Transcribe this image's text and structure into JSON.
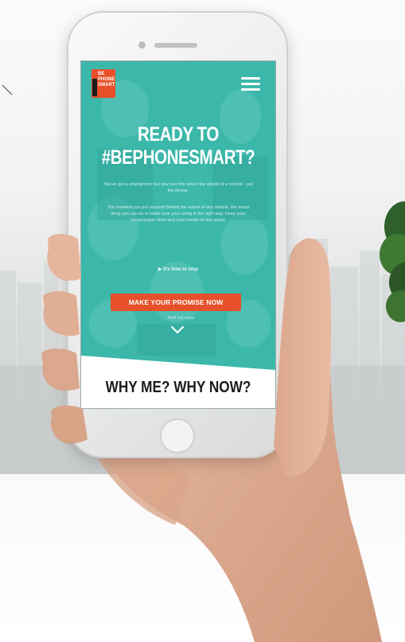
{
  "app": {
    "logo_lines": [
      "BE",
      "PHONE",
      "SMART"
    ],
    "menu_icon": "hamburger-menu-icon"
  },
  "hero": {
    "title_line1": "READY TO",
    "title_line2": "#BEPHONESMART?",
    "paragraph1": "You've got a smartphone but you lose the wheel the ahead of a vehicle - put the phone.",
    "paragraph2": "The moment you put yourself behind the wheel of any vehicle, the smart thing you can do is make sure your using in the right way. Keep your conversation short and your hands on the wheel.",
    "link_text": "▶ It's time to stop",
    "cta_label": "MAKE YOUR PROMISE NOW",
    "sublink_text": "→ Find out more",
    "scroll_icon": "chevron-down-icon"
  },
  "section": {
    "heading": "WHY ME? WHY NOW?"
  },
  "colors": {
    "screen_teal": "#3cb8ab",
    "accent_orange": "#e6502a",
    "heading_dark": "#1b1b1b"
  }
}
